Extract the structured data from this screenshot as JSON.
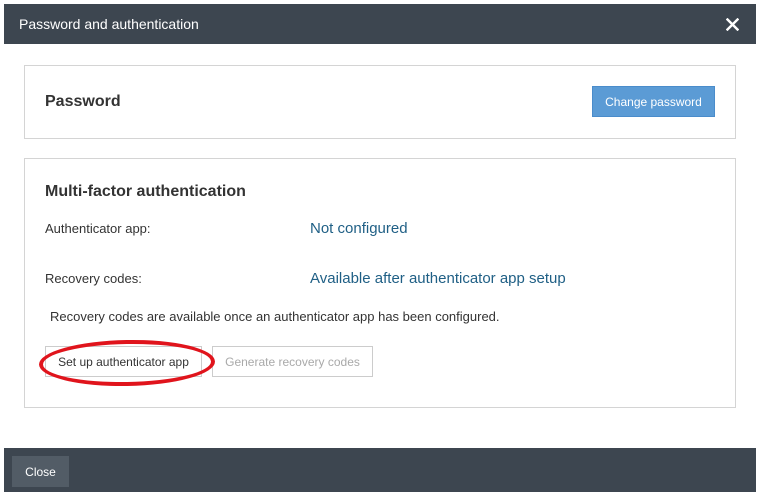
{
  "dialog": {
    "title": "Password and authentication",
    "close_icon": "close-icon"
  },
  "password_section": {
    "title": "Password",
    "change_button": "Change password"
  },
  "mfa_section": {
    "title": "Multi-factor authentication",
    "authenticator_label": "Authenticator app:",
    "authenticator_value": "Not configured",
    "recovery_label": "Recovery codes:",
    "recovery_value": "Available after authenticator app setup",
    "note": "Recovery codes are available once an authenticator app has been configured.",
    "setup_button": "Set up authenticator app",
    "generate_button": "Generate recovery codes"
  },
  "footer": {
    "close_button": "Close"
  },
  "colors": {
    "titlebar": "#3d4650",
    "primary_button": "#5b9bd5",
    "link_value": "#1f5f85",
    "highlight": "#e0141c"
  }
}
